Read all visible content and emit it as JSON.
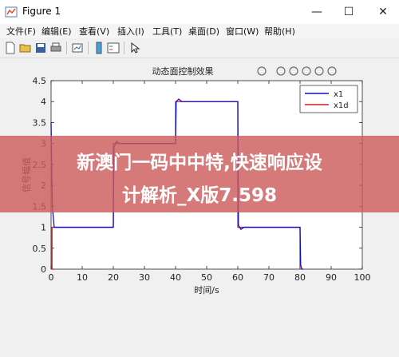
{
  "window": {
    "title": "Figure 1",
    "minimize_glyph": "—",
    "maximize_glyph": "☐",
    "close_glyph": "✕"
  },
  "menu": [
    "文件(F)",
    "编辑(E)",
    "查看(V)",
    "插入(I)",
    "工具(T)",
    "桌面(D)",
    "窗口(W)",
    "帮助(H)"
  ],
  "toolbar_icons": [
    "new-figure-icon",
    "open-file-icon",
    "save-icon",
    "print-icon",
    "link-plot-icon",
    "colorbar-icon",
    "legend-icon",
    "pointer-icon"
  ],
  "axes_toolbar_icons": [
    "edit-icon",
    "brush-icon",
    "pan-hand-icon",
    "zoom-in-icon",
    "zoom-out-icon",
    "home-icon"
  ],
  "banner": {
    "line1": "新澳门一码中中特,快速响应设",
    "line2": "计解析_X版7.598"
  },
  "chart_data": {
    "type": "line",
    "title": "动态面控制效果",
    "xlabel": "时间/s",
    "ylabel": "信号幅值",
    "xlim": [
      0,
      100
    ],
    "ylim": [
      0,
      4.5
    ],
    "xticks": [
      0,
      10,
      20,
      30,
      40,
      50,
      60,
      70,
      80,
      90,
      100
    ],
    "yticks": [
      0,
      0.5,
      1,
      1.5,
      2,
      2.5,
      3,
      3.5,
      4,
      4.5
    ],
    "grid": false,
    "legend_position": "top-right",
    "series": [
      {
        "name": "x1",
        "color": "#1010c0",
        "x": [
          0,
          0.1,
          0.4,
          1,
          20,
          20.2,
          21,
          22,
          40,
          40.2,
          41,
          42,
          60,
          60.2,
          61,
          62,
          80,
          80.2,
          80.6,
          81
        ],
        "y": [
          3.5,
          3.0,
          1.5,
          1.0,
          1.0,
          2.9,
          3.05,
          3.0,
          3.0,
          4.0,
          4.06,
          4.0,
          4.0,
          1.05,
          0.95,
          1.0,
          1.0,
          0.1,
          0.0,
          0.0
        ]
      },
      {
        "name": "x1d",
        "color": "#d02020",
        "x": [
          0,
          0.3,
          0.3,
          20,
          20,
          40,
          40,
          60,
          60,
          80,
          80
        ],
        "y": [
          0.0,
          0.0,
          1.0,
          1.0,
          3.0,
          3.0,
          4.0,
          4.0,
          1.0,
          1.0,
          0.0
        ]
      }
    ]
  }
}
